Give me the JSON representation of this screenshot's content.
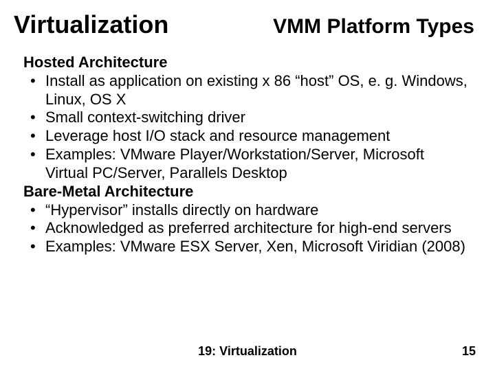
{
  "header": {
    "left": "Virtualization",
    "right": "VMM Platform Types"
  },
  "sections": [
    {
      "title": "Hosted Architecture",
      "bullets": [
        "Install as application on existing x 86 “host” OS, e. g. Windows, Linux, OS X",
        "Small context-switching driver",
        "Leverage host I/O stack and resource management",
        "Examples: VMware Player/Workstation/Server, Microsoft Virtual PC/Server, Parallels Desktop"
      ]
    },
    {
      "title": "Bare-Metal Architecture",
      "bullets": [
        "“Hypervisor” installs directly on hardware",
        "Acknowledged as preferred architecture for high-end servers",
        "Examples: VMware ESX Server, Xen, Microsoft Viridian (2008)"
      ]
    }
  ],
  "footer": {
    "center": "19: Virtualization",
    "page": "15"
  }
}
